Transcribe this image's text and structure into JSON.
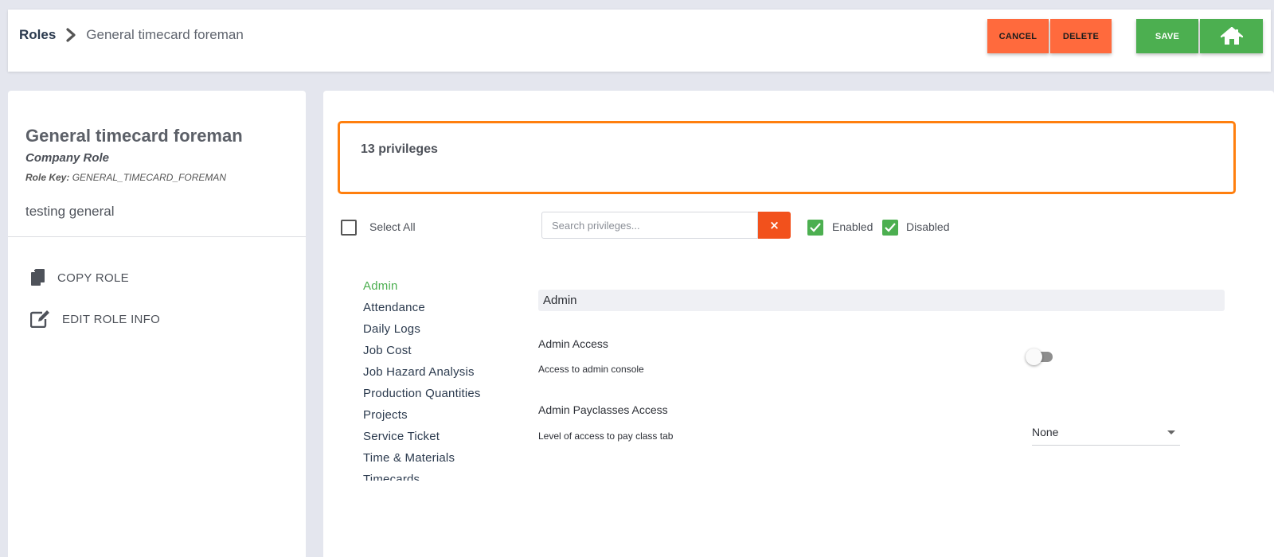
{
  "header": {
    "breadcrumb_root": "Roles",
    "breadcrumb_current": "General timecard foreman",
    "cancel_label": "CANCEL",
    "delete_label": "DELETE",
    "save_label": "SAVE",
    "home_icon": "home-icon"
  },
  "role": {
    "title": "General timecard foreman",
    "type": "Company Role",
    "key_label": "Role Key:",
    "key_value": "GENERAL_TIMECARD_FOREMAN",
    "description": "testing general"
  },
  "actions": {
    "copy_label": "COPY ROLE",
    "edit_label": "EDIT ROLE INFO"
  },
  "privileges": {
    "count_text": "13 privileges",
    "select_all_label": "Select All",
    "search_placeholder": "Search privileges...",
    "clear_label": "×",
    "enabled_label": "Enabled",
    "disabled_label": "Disabled",
    "categories": [
      "Admin",
      "Attendance",
      "Daily Logs",
      "Job Cost",
      "Job Hazard Analysis",
      "Production Quantities",
      "Projects",
      "Service Ticket",
      "Time & Materials",
      "Timecards"
    ],
    "active_category": "Admin",
    "section_title": "Admin",
    "items": [
      {
        "name": "Admin Access",
        "description": "Access to admin console",
        "control": "toggle",
        "enabled": false
      },
      {
        "name": "Admin Payclasses Access",
        "description": "Level of access to pay class tab",
        "control": "select",
        "value": "None"
      }
    ]
  },
  "colors": {
    "accent_orange": "#ff6a3d",
    "accent_green": "#4caf50",
    "highlight_border": "#ff7f0e",
    "clear_button": "#f2511c"
  }
}
